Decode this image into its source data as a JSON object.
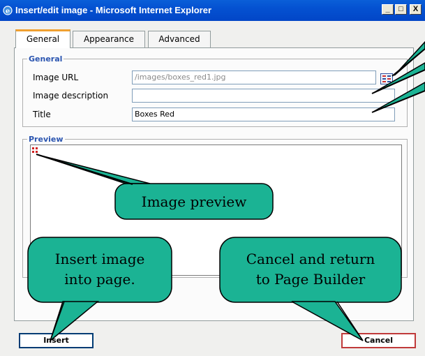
{
  "window": {
    "title": "Insert/edit image - Microsoft Internet Explorer",
    "minimize_glyph": "_",
    "maximize_glyph": "□",
    "close_glyph": "X"
  },
  "tabs": [
    {
      "label": "General",
      "active": true
    },
    {
      "label": "Appearance",
      "active": false
    },
    {
      "label": "Advanced",
      "active": false
    }
  ],
  "general": {
    "legend": "General",
    "image_url_label": "Image URL",
    "image_url_value": "/images/boxes_red1.jpg",
    "description_label": "Image description",
    "description_value": "",
    "title_label": "Title",
    "title_value": "Boxes Red",
    "browse_icon": "browse-icon"
  },
  "preview": {
    "legend": "Preview"
  },
  "buttons": {
    "insert": "Insert",
    "cancel": "Cancel"
  },
  "callouts": {
    "image_preview": "Image preview",
    "insert_line1": "Insert image",
    "insert_line2": "into page.",
    "cancel_line1": "Cancel and return",
    "cancel_line2": "to Page Builder"
  },
  "colors": {
    "callout_fill": "#1bb394",
    "title_bar": "#0451d1",
    "legend_text": "#2b55b0",
    "active_tab_accent": "#f0a030"
  }
}
